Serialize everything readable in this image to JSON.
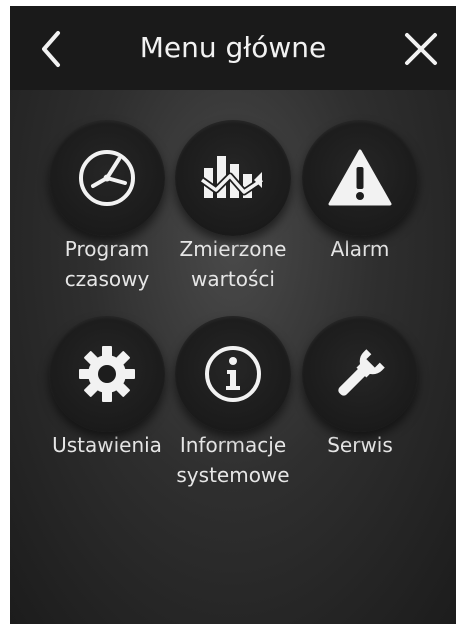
{
  "header": {
    "title": "Menu główne",
    "back_icon": "chevron-left-icon",
    "close_icon": "close-icon"
  },
  "tiles": [
    {
      "label": "Program\nczasowy",
      "icon": "clock-icon"
    },
    {
      "label": "Zmierzone\nwartości",
      "icon": "measured-values-icon"
    },
    {
      "label": "Alarm",
      "icon": "warning-icon"
    },
    {
      "label": "Ustawienia",
      "icon": "gear-icon"
    },
    {
      "label": "Informacje\nsystemowe",
      "icon": "info-icon"
    },
    {
      "label": "Serwis",
      "icon": "wrench-icon"
    }
  ],
  "colors": {
    "background": "#2f2f2f",
    "header": "#1a1a1a",
    "text": "#f2f2f2"
  }
}
